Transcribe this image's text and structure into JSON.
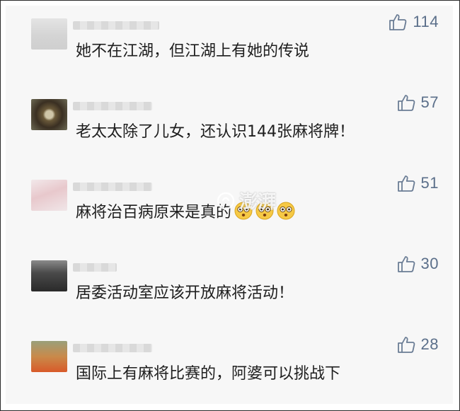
{
  "comments": [
    {
      "likes": "114",
      "text": "她不在江湖，但江湖上有她的传说",
      "emojis": []
    },
    {
      "likes": "57",
      "text": "老太太除了儿女，还认识144张麻将牌！",
      "emojis": []
    },
    {
      "likes": "51",
      "text": "麻将治百病原来是真的",
      "emojis": [
        "dizzy-face-icon",
        "dizzy-face-icon",
        "dizzy-face-icon"
      ]
    },
    {
      "likes": "30",
      "text": "居委活动室应该开放麻将活动！",
      "emojis": []
    },
    {
      "likes": "28",
      "text": "国际上有麻将比赛的，阿婆可以挑战下",
      "emojis": []
    }
  ],
  "watermark": {
    "text": "澎湃"
  },
  "colors": {
    "panel_bg": "#f7f7f7",
    "like_color": "#5b6f8a",
    "text_color": "#1e1e1e"
  }
}
